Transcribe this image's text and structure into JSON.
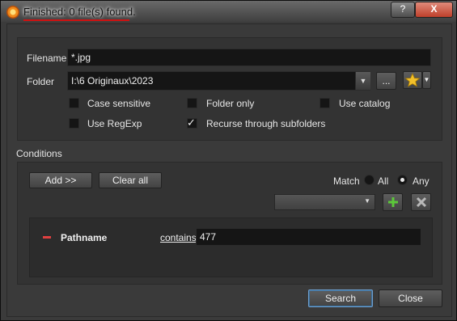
{
  "titlebar": {
    "title": "Finished: 0 file(s) found.",
    "help_label": "?",
    "close_label": "X"
  },
  "search": {
    "filename_label": "Filename",
    "filename_value": "*.jpg",
    "folder_label": "Folder",
    "folder_value": "I:\\6 Originaux\\2023",
    "browse_label": "...",
    "options": {
      "case_sensitive": {
        "label": "Case sensitive",
        "checked": false
      },
      "folder_only": {
        "label": "Folder only",
        "checked": false
      },
      "use_catalog": {
        "label": "Use catalog",
        "checked": false
      },
      "use_regexp": {
        "label": "Use RegExp",
        "checked": false
      },
      "recurse": {
        "label": "Recurse through subfolders",
        "checked": true
      }
    }
  },
  "conditions": {
    "section_label": "Conditions",
    "add_label": "Add >>",
    "clear_label": "Clear all",
    "match_label": "Match",
    "match_all_label": "All",
    "match_any_label": "Any",
    "match_selected": "Any",
    "items": [
      {
        "name": "Pathname",
        "operator": "contains",
        "value": "477"
      }
    ]
  },
  "footer": {
    "search_label": "Search",
    "close_label": "Close"
  },
  "colors": {
    "title_underline": "#d01010",
    "add_icon": "#5cc93a",
    "remove_icon": "#e04040"
  }
}
